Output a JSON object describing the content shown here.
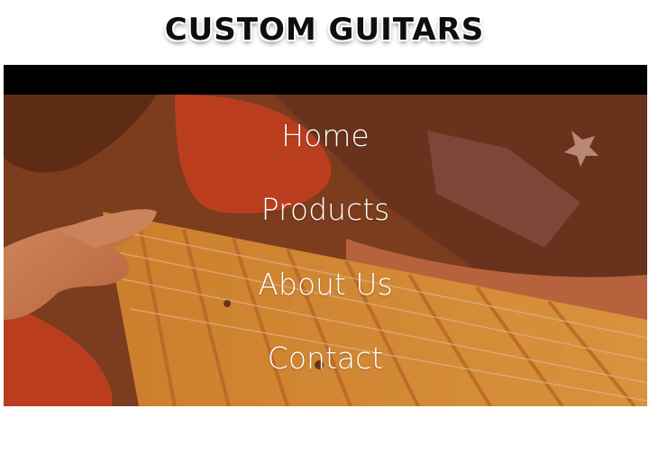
{
  "header": {
    "title": "CUSTOM GUITARS"
  },
  "nav": {
    "items": [
      {
        "label": "Home"
      },
      {
        "label": "Products"
      },
      {
        "label": "About Us"
      },
      {
        "label": "Contact"
      }
    ]
  },
  "colors": {
    "accent_overlay": "#be5523",
    "bar": "#000000",
    "nav_text": "#ffffff"
  }
}
